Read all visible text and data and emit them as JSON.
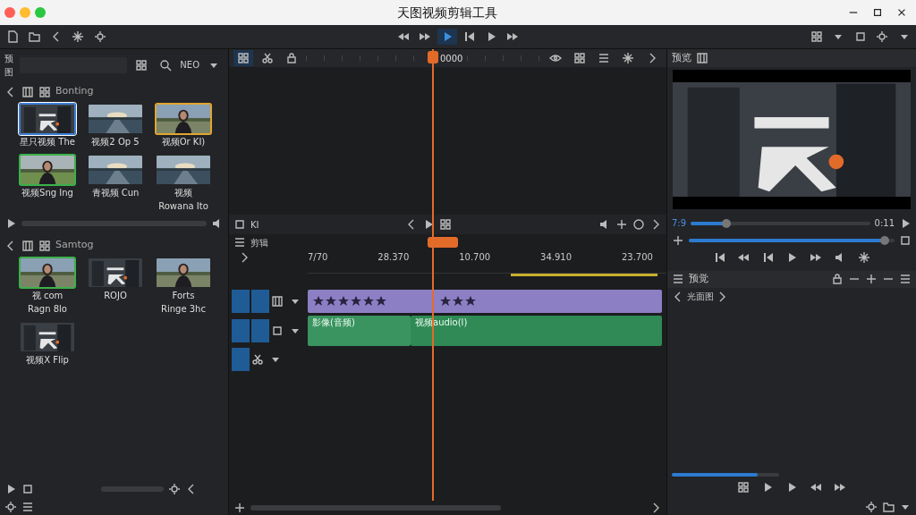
{
  "window": {
    "title": "天图视频剪辑工具"
  },
  "library": {
    "label": "预图",
    "view_label": "NEO",
    "bins": [
      {
        "title": "Bonting",
        "clips": [
          {
            "labels": [
              "星只视频 The"
            ],
            "color": "#3d7fd6",
            "selected": true
          },
          {
            "labels": [
              "视频2 Op 5"
            ],
            "selected": false
          },
          {
            "labels": [
              "视频Or KI)"
            ],
            "color": "#e0a630",
            "selected": false
          },
          {
            "labels": [
              "视频Sng Ing"
            ],
            "color": "#3cb04a",
            "selected": false
          },
          {
            "labels": [
              "青视频 Cun"
            ],
            "selected": false
          },
          {
            "labels": [
              "视频",
              "Rowana Ito"
            ],
            "selected": false
          }
        ]
      },
      {
        "title": "Samtog",
        "clips": [
          {
            "labels": [
              "视 com",
              "Ragn 8lo"
            ],
            "color": "#3cb04a",
            "selected": false
          },
          {
            "labels": [
              "ROJO"
            ],
            "selected": false
          },
          {
            "labels": [
              "Forts",
              "Ringe 3hc"
            ],
            "selected": false
          },
          {
            "labels": [
              "视频X Flip"
            ],
            "selected": false
          }
        ]
      }
    ]
  },
  "timeline": {
    "playhead": "0000",
    "tool_label": "KI",
    "track_label": "剪辑",
    "ruler": [
      "7/70",
      "28.370",
      "10.700",
      "34.910",
      "23.700"
    ],
    "video_clips": [
      {
        "stars": 6
      },
      {
        "stars": 3
      }
    ],
    "audio_clips": [
      {
        "label": "影像(音频)"
      },
      {
        "label": "视频audio(l)"
      }
    ]
  },
  "preview": {
    "label": "预览",
    "time": "7:9",
    "duration": "0:11",
    "scrub": {
      "level": 0.2
    },
    "volume": {
      "level": 0.95
    }
  },
  "panel": {
    "label": "预觉",
    "breadcrumb": "光面图",
    "progress": {
      "level": 0.8
    }
  }
}
